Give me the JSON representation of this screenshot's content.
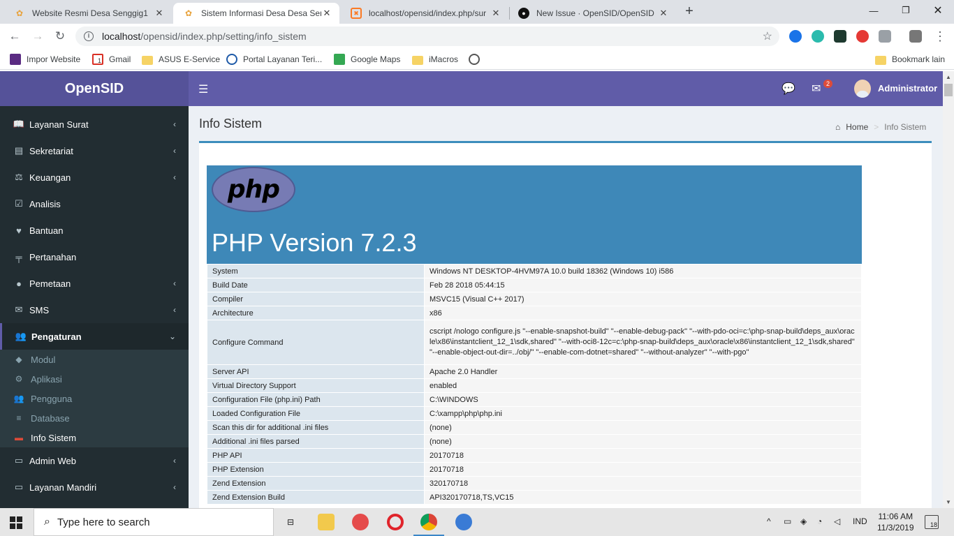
{
  "browser": {
    "tabs": [
      {
        "title": "Website Resmi Desa Senggig1",
        "active": false
      },
      {
        "title": "Sistem Informasi Desa Desa Seng",
        "active": true
      },
      {
        "title": "localhost/opensid/index.php/sur",
        "active": false
      },
      {
        "title": "New Issue · OpenSID/OpenSID",
        "active": false
      }
    ],
    "url_host": "localhost",
    "url_path": "/opensid/index.php/setting/info_sistem",
    "bookmarks": [
      "Impor Website",
      "Gmail",
      "ASUS E-Service",
      "Portal Layanan Teri...",
      "Google Maps",
      "iMacros"
    ],
    "bookmark_other": "Bookmark lain",
    "gmail_badge": "1"
  },
  "app": {
    "logo": "OpenSID",
    "notif_count": "2",
    "user": "Administrator"
  },
  "sidebar": {
    "items": [
      {
        "label": "Layanan Surat",
        "icon": "book-icon",
        "glyph": "📖",
        "chevron": true
      },
      {
        "label": "Sekretariat",
        "icon": "archive-icon",
        "glyph": "▤",
        "chevron": true
      },
      {
        "label": "Keuangan",
        "icon": "balance-icon",
        "glyph": "⚖",
        "chevron": true
      },
      {
        "label": "Analisis",
        "icon": "checkbox-icon",
        "glyph": "☑",
        "chevron": false
      },
      {
        "label": "Bantuan",
        "icon": "heart-icon",
        "glyph": "♥",
        "chevron": false
      },
      {
        "label": "Pertanahan",
        "icon": "map-signs-icon",
        "glyph": "╤",
        "chevron": false
      },
      {
        "label": "Pemetaan",
        "icon": "globe-icon",
        "glyph": "●",
        "chevron": true
      },
      {
        "label": "SMS",
        "icon": "envelope-icon",
        "glyph": "✉",
        "chevron": true
      },
      {
        "label": "Pengaturan",
        "icon": "users-icon",
        "glyph": "👥",
        "chevron": true,
        "active": true
      }
    ],
    "submenu": [
      {
        "label": "Modul",
        "icon": "tags-icon",
        "glyph": "◆"
      },
      {
        "label": "Aplikasi",
        "icon": "cog-icon",
        "glyph": "⚙"
      },
      {
        "label": "Pengguna",
        "icon": "users-icon",
        "glyph": "👥"
      },
      {
        "label": "Database",
        "icon": "database-icon",
        "glyph": "≡"
      },
      {
        "label": "Info Sistem",
        "icon": "server-icon",
        "glyph": "▬",
        "current": true
      }
    ],
    "items_after": [
      {
        "label": "Admin Web",
        "icon": "desktop-icon",
        "glyph": "▭",
        "chevron": true
      },
      {
        "label": "Layanan Mandiri",
        "icon": "monitor-icon",
        "glyph": "▭",
        "chevron": true
      }
    ]
  },
  "page": {
    "title": "Info Sistem",
    "breadcrumb_home": "Home",
    "breadcrumb_current": "Info Sistem"
  },
  "phpinfo": {
    "logo_text": "php",
    "version_title": "PHP Version 7.2.3",
    "rows": [
      [
        "System",
        "Windows NT DESKTOP-4HVM97A 10.0 build 18362 (Windows 10) i586"
      ],
      [
        "Build Date",
        "Feb 28 2018 05:44:15"
      ],
      [
        "Compiler",
        "MSVC15 (Visual C++ 2017)"
      ],
      [
        "Architecture",
        "x86"
      ],
      [
        "Configure Command",
        "cscript /nologo configure.js \"--enable-snapshot-build\" \"--enable-debug-pack\" \"--with-pdo-oci=c:\\php-snap-build\\deps_aux\\oracle\\x86\\instantclient_12_1\\sdk,shared\" \"--with-oci8-12c=c:\\php-snap-build\\deps_aux\\oracle\\x86\\instantclient_12_1\\sdk,shared\" \"--enable-object-out-dir=../obj/\" \"--enable-com-dotnet=shared\" \"--without-analyzer\" \"--with-pgo\""
      ],
      [
        "Server API",
        "Apache 2.0 Handler"
      ],
      [
        "Virtual Directory Support",
        "enabled"
      ],
      [
        "Configuration File (php.ini) Path",
        "C:\\WINDOWS"
      ],
      [
        "Loaded Configuration File",
        "C:\\xampp\\php\\php.ini"
      ],
      [
        "Scan this dir for additional .ini files",
        "(none)"
      ],
      [
        "Additional .ini files parsed",
        "(none)"
      ],
      [
        "PHP API",
        "20170718"
      ],
      [
        "PHP Extension",
        "20170718"
      ],
      [
        "Zend Extension",
        "320170718"
      ],
      [
        "Zend Extension Build",
        "API320170718,TS,VC15"
      ]
    ]
  },
  "taskbar": {
    "search_placeholder": "Type here to search",
    "lang": "IND",
    "time": "11:06 AM",
    "date": "11/3/2019",
    "notif_count": "18"
  }
}
